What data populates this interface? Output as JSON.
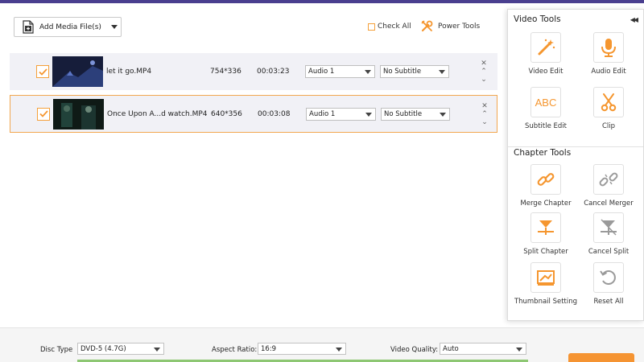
{
  "toolbar": {
    "add_media_label": "Add Media File(s)",
    "check_all_label": "Check All",
    "power_tools_label": "Power Tools"
  },
  "files": [
    {
      "name": "let it go.MP4",
      "resolution": "754*336",
      "duration": "00:03:23",
      "audio": "Audio 1",
      "subtitle": "No Subtitle",
      "checked": true,
      "selected": false
    },
    {
      "name": "Once Upon A...d watch.MP4",
      "resolution": "640*356",
      "duration": "00:03:08",
      "audio": "Audio 1",
      "subtitle": "No Subtitle",
      "checked": true,
      "selected": true
    }
  ],
  "panel": {
    "video_tools_title": "Video Tools",
    "chapter_tools_title": "Chapter Tools",
    "video_tools": [
      {
        "label": "Video Edit",
        "icon": "magic-wand-icon"
      },
      {
        "label": "Audio Edit",
        "icon": "microphone-icon"
      },
      {
        "label": "Subtitle Edit",
        "icon": "abc-text-icon",
        "icon_text": "ABC"
      },
      {
        "label": "Clip",
        "icon": "scissors-icon"
      }
    ],
    "chapter_tools": [
      {
        "label": "Merge Chapter",
        "icon": "link-icon"
      },
      {
        "label": "Cancel Merger",
        "icon": "unlink-icon"
      },
      {
        "label": "Split Chapter",
        "icon": "split-icon"
      },
      {
        "label": "Cancel Split",
        "icon": "cancel-split-icon"
      },
      {
        "label": "Thumbnail Setting",
        "icon": "thumbnail-icon"
      },
      {
        "label": "Reset All",
        "icon": "reset-icon"
      }
    ]
  },
  "settings": {
    "disc_type_label": "Disc Type",
    "disc_type_value": "DVD-5 (4.7G)",
    "aspect_ratio_label": "Aspect Ratio:",
    "aspect_ratio_value": "16:9",
    "video_quality_label": "Video Quality:",
    "video_quality_value": "Auto"
  },
  "colors": {
    "accent": "#f5962f",
    "selected_border": "#f2a750",
    "row_bg": "#f1f1f6",
    "progress": "#8dc773"
  }
}
